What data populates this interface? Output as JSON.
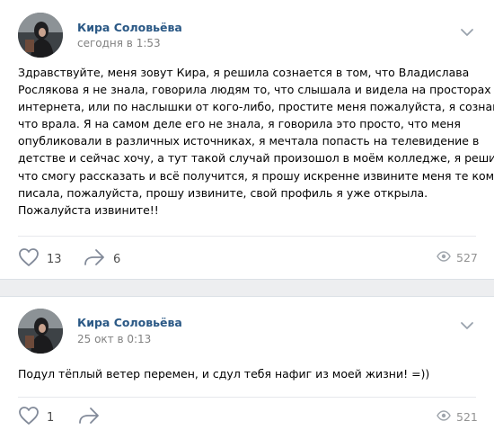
{
  "colors": {
    "page_background": "#edeef0",
    "author_link": "#2a5885",
    "meta_gray": "#828282"
  },
  "posts": [
    {
      "author": "Кира Соловьёва",
      "date": "сегодня в 1:53",
      "text_lines": [
        "Здравствуйте, меня зовут Кира, я решила сознается в том, что Владислава",
        "Рослякова я не знала, говорила людям то, что слышала и видела на просторах",
        "интернета, или по наслышки от кого-либо, простите меня пожалуйста, я сознаюсь,",
        "что врала. Я на самом деле его не знала, я говорила это просто, что меня",
        "опубликовали в различных источниках, я мечтала попасть на телевидение в",
        "детстве и сейчас хочу, а тут такой случай произошол в моём колледже, я решила,",
        "что смогу рассказать и всё получится, я прошу искренне извините меня те кому я",
        "писала, пожалуйста, прошу извините, свой профиль я уже открыла.",
        "Пожалуйста извините!!"
      ],
      "likes": "13",
      "shares": "6",
      "views": "527",
      "icons": {
        "like": "heart-icon",
        "share": "share-arrow-icon",
        "views": "eye-icon",
        "menu": "chevron-down-icon"
      }
    },
    {
      "author": "Кира Соловьёва",
      "date": "25 окт в 0:13",
      "text_lines": [
        "Подул тёплый ветер перемен, и сдул тебя нафиг из моей жизни! =))"
      ],
      "likes": "1",
      "shares": "",
      "views": "521",
      "icons": {
        "like": "heart-icon",
        "share": "share-arrow-icon",
        "views": "eye-icon",
        "menu": "chevron-down-icon"
      }
    }
  ]
}
